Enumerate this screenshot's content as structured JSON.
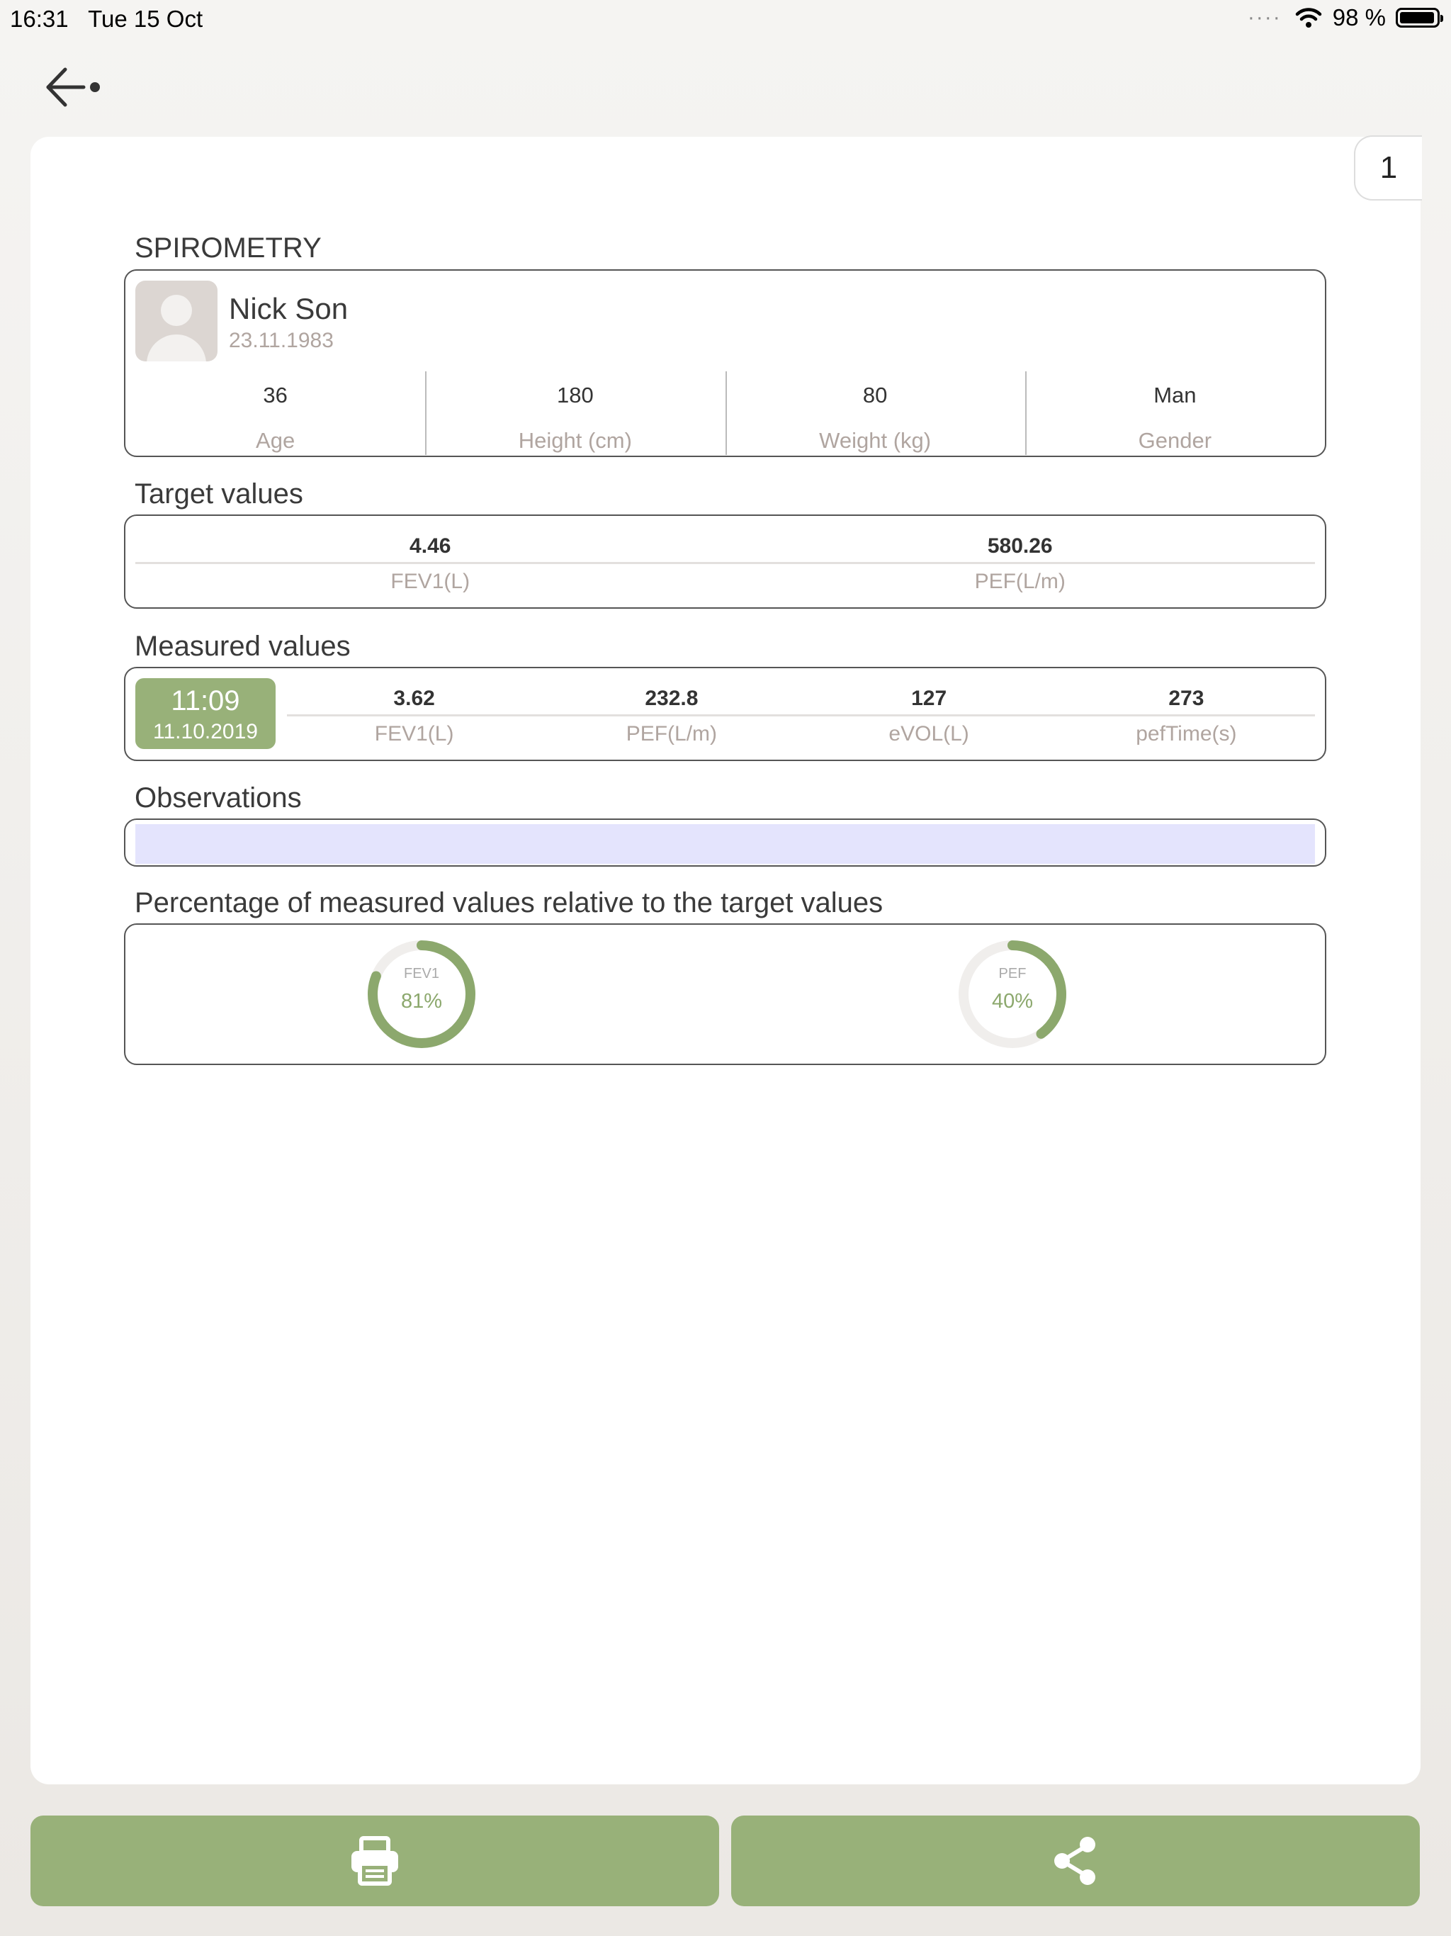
{
  "status_bar": {
    "time": "16:31",
    "date": "Tue 15 Oct",
    "battery": "98 %",
    "battery_level": 0.98
  },
  "page_number": "1",
  "spirometry": {
    "title": "SPIROMETRY",
    "patient": {
      "name": "Nick Son",
      "dob": "23.11.1983"
    },
    "stats": [
      {
        "value": "36",
        "label": "Age"
      },
      {
        "value": "180",
        "label": "Height (cm)"
      },
      {
        "value": "80",
        "label": "Weight (kg)"
      },
      {
        "value": "Man",
        "label": "Gender"
      }
    ]
  },
  "target": {
    "title": "Target values",
    "items": [
      {
        "value": "4.46",
        "label": "FEV1(L)"
      },
      {
        "value": "580.26",
        "label": "PEF(L/m)"
      }
    ]
  },
  "measured": {
    "title": "Measured values",
    "time": "11:09",
    "date": "11.10.2019",
    "items": [
      {
        "value": "3.62",
        "label": "FEV1(L)"
      },
      {
        "value": "232.8",
        "label": "PEF(L/m)"
      },
      {
        "value": "127",
        "label": "eVOL(L)"
      },
      {
        "value": "273",
        "label": "pefTime(s)"
      }
    ]
  },
  "observations": {
    "title": "Observations",
    "value": ""
  },
  "percentage": {
    "title": "Percentage of measured values relative to the target values",
    "items": [
      {
        "label": "FEV1",
        "percent_text": "81%",
        "percent": 81
      },
      {
        "label": "PEF",
        "percent_text": "40%",
        "percent": 40
      }
    ]
  },
  "colors": {
    "accent": "#98b179",
    "ring": "#8ca86d",
    "ring_track": "#f0eeec"
  },
  "icons": {
    "back": "back-arrow-icon",
    "print": "printer-icon",
    "share": "share-icon"
  }
}
